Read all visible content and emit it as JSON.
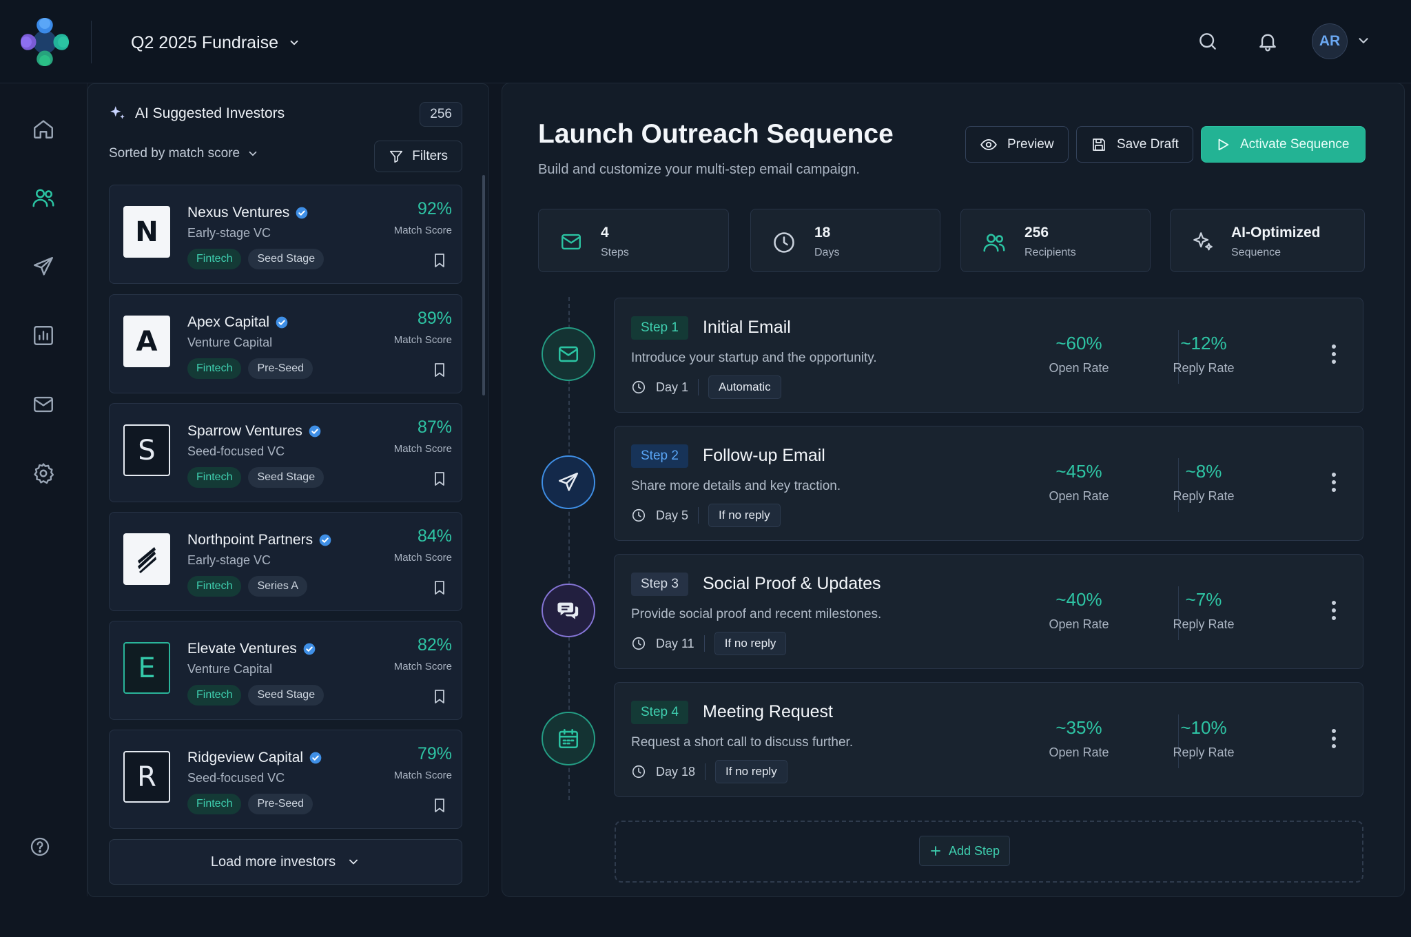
{
  "header": {
    "project_title": "Q2 2025 Fundraise",
    "avatar_initials": "AR"
  },
  "sidebar": {
    "items": [
      {
        "name": "home",
        "icon": "home-icon",
        "active": false
      },
      {
        "name": "investors",
        "icon": "users-icon",
        "active": true
      },
      {
        "name": "outreach",
        "icon": "send-icon",
        "active": false
      },
      {
        "name": "analytics",
        "icon": "chart-icon",
        "active": false
      },
      {
        "name": "inbox",
        "icon": "mail-icon",
        "active": false
      },
      {
        "name": "settings",
        "icon": "gear-icon",
        "active": false
      }
    ],
    "help_icon": "help-icon"
  },
  "investors_panel": {
    "title": "AI Suggested Investors",
    "count": "256",
    "sort_label": "Sorted by match score",
    "filters_label": "Filters",
    "score_label": "Match Score",
    "load_more_label": "Load more investors",
    "items": [
      {
        "logo": "N",
        "name": "Nexus Ventures",
        "type": "Early-stage VC",
        "score": "92%",
        "tags": [
          "Fintech",
          "Seed Stage"
        ]
      },
      {
        "logo": "A",
        "name": "Apex Capital",
        "type": "Venture Capital",
        "score": "89%",
        "tags": [
          "Fintech",
          "Pre-Seed"
        ]
      },
      {
        "logo": "S",
        "name": "Sparrow Ventures",
        "type": "Seed-focused VC",
        "score": "87%",
        "tags": [
          "Fintech",
          "Seed Stage"
        ]
      },
      {
        "logo": "",
        "name": "Northpoint Partners",
        "type": "Early-stage VC",
        "score": "84%",
        "tags": [
          "Fintech",
          "Series A"
        ]
      },
      {
        "logo": "E",
        "name": "Elevate Ventures",
        "type": "Venture Capital",
        "score": "82%",
        "tags": [
          "Fintech",
          "Seed Stage"
        ]
      },
      {
        "logo": "R",
        "name": "Ridgeview Capital",
        "type": "Seed-focused VC",
        "score": "79%",
        "tags": [
          "Fintech",
          "Pre-Seed"
        ]
      }
    ]
  },
  "main": {
    "title": "Launch Outreach Sequence",
    "subtitle": "Build and customize your multi-step email campaign.",
    "buttons": {
      "preview": "Preview",
      "save_draft": "Save Draft",
      "activate": "Activate Sequence"
    },
    "stats": [
      {
        "value": "4",
        "label": "Steps",
        "icon": "mail-icon"
      },
      {
        "value": "18",
        "label": "Days",
        "icon": "clock-icon"
      },
      {
        "value": "256",
        "label": "Recipients",
        "icon": "users-icon"
      },
      {
        "value": "AI-Optimized",
        "label": "Sequence",
        "icon": "sparkle-icon"
      }
    ],
    "open_rate_label": "Open Rate",
    "reply_rate_label": "Reply Rate",
    "steps": [
      {
        "badge": "Step 1",
        "title": "Initial Email",
        "description": "Introduce your startup and the opportunity.",
        "day": "Day 1",
        "condition": "Automatic",
        "open_rate": "~60%",
        "reply_rate": "~12%",
        "icon": "mail-icon"
      },
      {
        "badge": "Step 2",
        "title": "Follow-up Email",
        "description": "Share more details and key traction.",
        "day": "Day 5",
        "condition": "If no reply",
        "open_rate": "~45%",
        "reply_rate": "~8%",
        "icon": "send-icon"
      },
      {
        "badge": "Step 3",
        "title": "Social Proof & Updates",
        "description": "Provide social proof and recent milestones.",
        "day": "Day 11",
        "condition": "If no reply",
        "open_rate": "~40%",
        "reply_rate": "~7%",
        "icon": "chat-icon"
      },
      {
        "badge": "Step 4",
        "title": "Meeting Request",
        "description": "Request a short call to discuss further.",
        "day": "Day 18",
        "condition": "If no reply",
        "open_rate": "~35%",
        "reply_rate": "~10%",
        "icon": "calendar-icon"
      }
    ],
    "add_step_label": "Add Step"
  },
  "colors": {
    "accent": "#23b394",
    "accent_text": "#2ec4a4",
    "blue": "#3f8fe6",
    "purple": "#8575d6",
    "background": "#0f1621",
    "panel": "#131c28"
  }
}
